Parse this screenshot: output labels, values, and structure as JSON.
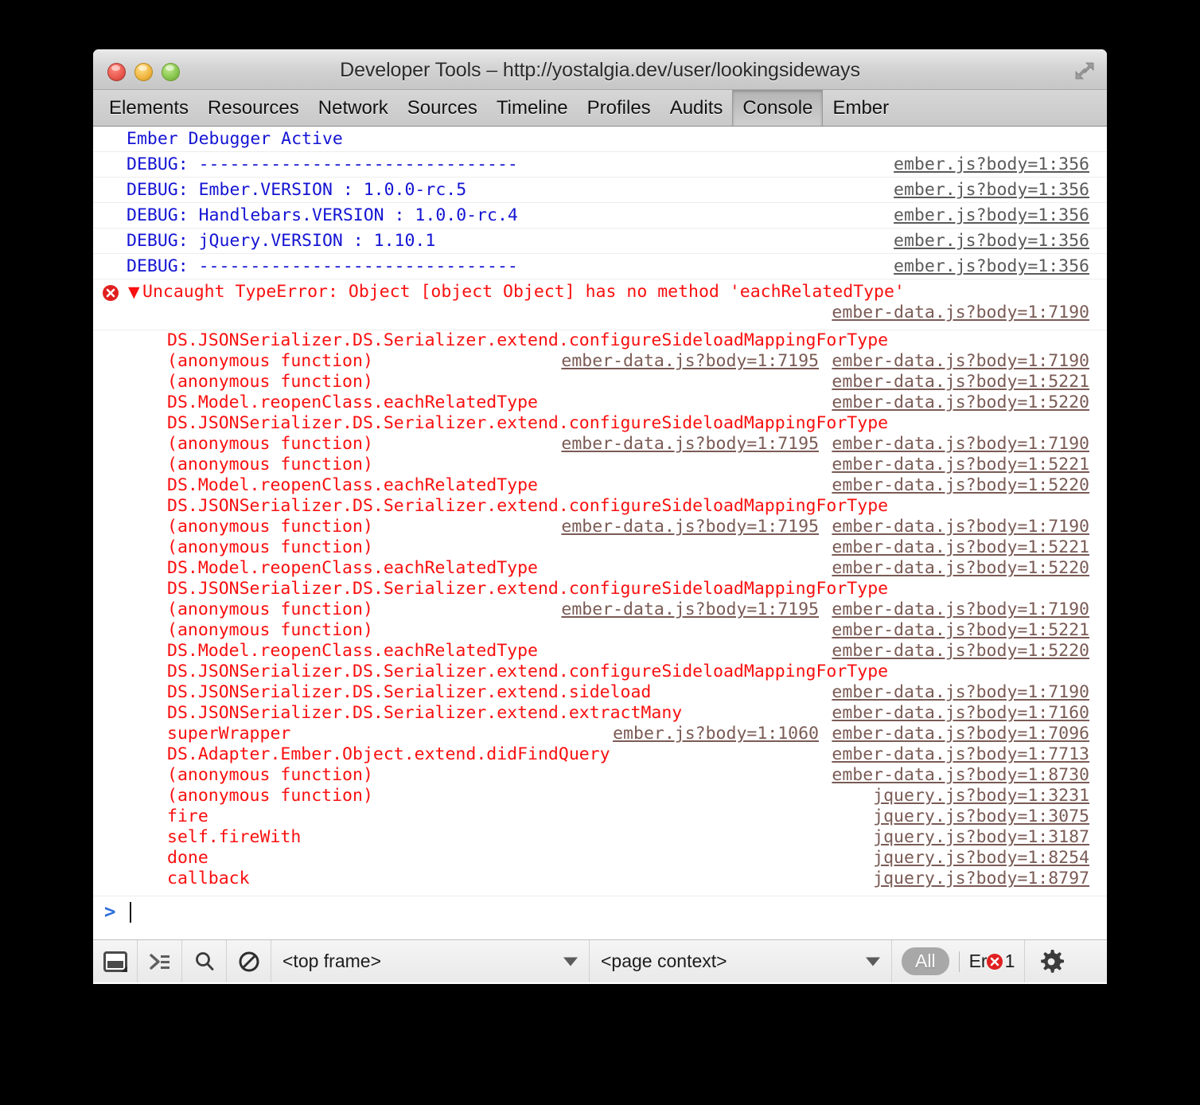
{
  "window": {
    "title": "Developer Tools – http://yostalgia.dev/user/lookingsideways",
    "controls": {
      "close": "close",
      "minimize": "minimize",
      "zoom": "zoom"
    },
    "resize_icon": "expand-arrows-icon"
  },
  "tabs": [
    {
      "label": "Elements",
      "active": false
    },
    {
      "label": "Resources",
      "active": false
    },
    {
      "label": "Network",
      "active": false
    },
    {
      "label": "Sources",
      "active": false
    },
    {
      "label": "Timeline",
      "active": false
    },
    {
      "label": "Profiles",
      "active": false
    },
    {
      "label": "Audits",
      "active": false
    },
    {
      "label": "Console",
      "active": true
    },
    {
      "label": "Ember",
      "active": false
    }
  ],
  "console": {
    "messages": [
      {
        "level": "debug",
        "text": "Ember Debugger Active",
        "link": ""
      },
      {
        "level": "debug",
        "text": "DEBUG: -------------------------------",
        "link": "ember.js?body=1:356"
      },
      {
        "level": "debug",
        "text": "DEBUG: Ember.VERSION : 1.0.0-rc.5",
        "link": "ember.js?body=1:356"
      },
      {
        "level": "debug",
        "text": "DEBUG: Handlebars.VERSION : 1.0.0-rc.4",
        "link": "ember.js?body=1:356"
      },
      {
        "level": "debug",
        "text": "DEBUG: jQuery.VERSION : 1.10.1",
        "link": "ember.js?body=1:356"
      },
      {
        "level": "debug",
        "text": "DEBUG: -------------------------------",
        "link": "ember.js?body=1:356"
      }
    ],
    "error": {
      "icon": "error-circle-icon",
      "disclosure": "▼",
      "text": "Uncaught TypeError: Object [object Object] has no method 'eachRelatedType'",
      "top_link": "ember-data.js?body=1:7190",
      "frames": [
        {
          "fn": "DS.JSONSerializer.DS.Serializer.extend.configureSideloadMappingForType",
          "mid": "",
          "url": ""
        },
        {
          "fn": "(anonymous function)",
          "mid": "ember-data.js?body=1:7195",
          "url": "ember-data.js?body=1:7190"
        },
        {
          "fn": "(anonymous function)",
          "mid": "",
          "url": "ember-data.js?body=1:5221"
        },
        {
          "fn": "DS.Model.reopenClass.eachRelatedType",
          "mid": "",
          "url": "ember-data.js?body=1:5220"
        },
        {
          "fn": "DS.JSONSerializer.DS.Serializer.extend.configureSideloadMappingForType",
          "mid": "",
          "url": ""
        },
        {
          "fn": "(anonymous function)",
          "mid": "ember-data.js?body=1:7195",
          "url": "ember-data.js?body=1:7190"
        },
        {
          "fn": "(anonymous function)",
          "mid": "",
          "url": "ember-data.js?body=1:5221"
        },
        {
          "fn": "DS.Model.reopenClass.eachRelatedType",
          "mid": "",
          "url": "ember-data.js?body=1:5220"
        },
        {
          "fn": "DS.JSONSerializer.DS.Serializer.extend.configureSideloadMappingForType",
          "mid": "",
          "url": ""
        },
        {
          "fn": "(anonymous function)",
          "mid": "ember-data.js?body=1:7195",
          "url": "ember-data.js?body=1:7190"
        },
        {
          "fn": "(anonymous function)",
          "mid": "",
          "url": "ember-data.js?body=1:5221"
        },
        {
          "fn": "DS.Model.reopenClass.eachRelatedType",
          "mid": "",
          "url": "ember-data.js?body=1:5220"
        },
        {
          "fn": "DS.JSONSerializer.DS.Serializer.extend.configureSideloadMappingForType",
          "mid": "",
          "url": ""
        },
        {
          "fn": "(anonymous function)",
          "mid": "ember-data.js?body=1:7195",
          "url": "ember-data.js?body=1:7190"
        },
        {
          "fn": "(anonymous function)",
          "mid": "",
          "url": "ember-data.js?body=1:5221"
        },
        {
          "fn": "DS.Model.reopenClass.eachRelatedType",
          "mid": "",
          "url": "ember-data.js?body=1:5220"
        },
        {
          "fn": "DS.JSONSerializer.DS.Serializer.extend.configureSideloadMappingForType",
          "mid": "",
          "url": ""
        },
        {
          "fn": "DS.JSONSerializer.DS.Serializer.extend.sideload",
          "mid": "",
          "url": "ember-data.js?body=1:7190"
        },
        {
          "fn": "DS.JSONSerializer.DS.Serializer.extend.extractMany",
          "mid": "",
          "url": "ember-data.js?body=1:7160"
        },
        {
          "fn": "superWrapper",
          "mid": "ember.js?body=1:1060",
          "url": "ember-data.js?body=1:7096"
        },
        {
          "fn": "DS.Adapter.Ember.Object.extend.didFindQuery",
          "mid": "",
          "url": "ember-data.js?body=1:7713"
        },
        {
          "fn": "(anonymous function)",
          "mid": "",
          "url": "ember-data.js?body=1:8730"
        },
        {
          "fn": "(anonymous function)",
          "mid": "",
          "url": "jquery.js?body=1:3231"
        },
        {
          "fn": "fire",
          "mid": "",
          "url": "jquery.js?body=1:3075"
        },
        {
          "fn": "self.fireWith",
          "mid": "",
          "url": "jquery.js?body=1:3187"
        },
        {
          "fn": "done",
          "mid": "",
          "url": "jquery.js?body=1:8254"
        },
        {
          "fn": "callback",
          "mid": "",
          "url": "jquery.js?body=1:8797"
        }
      ]
    },
    "prompt": {
      "chevron": ">",
      "value": ""
    }
  },
  "statusbar": {
    "dock_icon": "dock-panel-icon",
    "console_icon": "show-console-icon",
    "search_icon": "search-icon",
    "clear_icon": "clear-console-icon",
    "frame_select": "<top frame>",
    "context_select": "<page context>",
    "filter_all": "All",
    "filter_errors_label": "Er",
    "filter_errors_count": "1",
    "error_badge_icon": "error-circle-icon",
    "gear_icon": "gear-icon"
  },
  "colors": {
    "debug_blue": "#1414d4",
    "error_red": "#fa0f0f",
    "link_gray": "#7a5b55",
    "accent_blue": "#2f6fdd"
  }
}
